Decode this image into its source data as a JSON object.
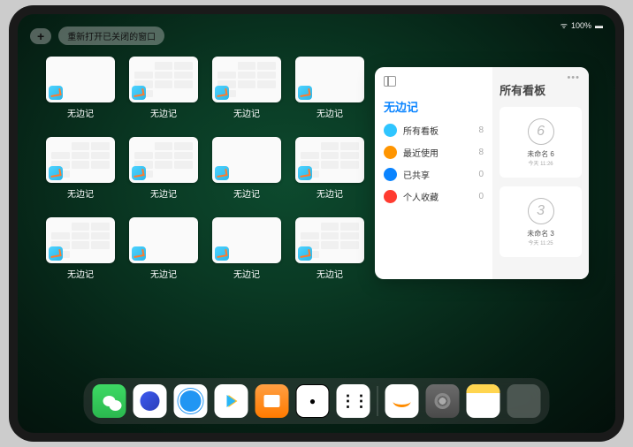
{
  "statusbar": {
    "battery": "100%"
  },
  "topbar": {
    "plus": "+",
    "reopen_label": "重新打开已关闭的窗口"
  },
  "windows": [
    {
      "label": "无边记",
      "variant": "blank"
    },
    {
      "label": "无边记",
      "variant": "calendar"
    },
    {
      "label": "无边记",
      "variant": "calendar"
    },
    {
      "label": "无边记",
      "variant": "blank"
    },
    {
      "label": "无边记",
      "variant": "calendar"
    },
    {
      "label": "无边记",
      "variant": "calendar"
    },
    {
      "label": "无边记",
      "variant": "blank"
    },
    {
      "label": "无边记",
      "variant": "calendar"
    },
    {
      "label": "无边记",
      "variant": "calendar"
    },
    {
      "label": "无边记",
      "variant": "blank"
    },
    {
      "label": "无边记",
      "variant": "blank"
    },
    {
      "label": "无边记",
      "variant": "calendar"
    }
  ],
  "panel": {
    "sidebar_title": "无边记",
    "main_title": "所有看板",
    "categories": [
      {
        "icon_color": "#2fc5ff",
        "label": "所有看板",
        "count": "8"
      },
      {
        "icon_color": "#ff9500",
        "label": "最近使用",
        "count": "8"
      },
      {
        "icon_color": "#0a84ff",
        "label": "已共享",
        "count": "0"
      },
      {
        "icon_color": "#ff3b30",
        "label": "个人收藏",
        "count": "0"
      }
    ],
    "boards": [
      {
        "sketch": "6",
        "name": "未命名 6",
        "sub": "今天 11:26"
      },
      {
        "sketch": "3",
        "name": "未命名 3",
        "sub": "今天 11:25"
      }
    ]
  },
  "dock": {
    "icons": [
      "wechat",
      "blue1",
      "blue2",
      "play",
      "books",
      "dice",
      "dots",
      "freeform",
      "settings",
      "notes",
      "folder"
    ]
  }
}
